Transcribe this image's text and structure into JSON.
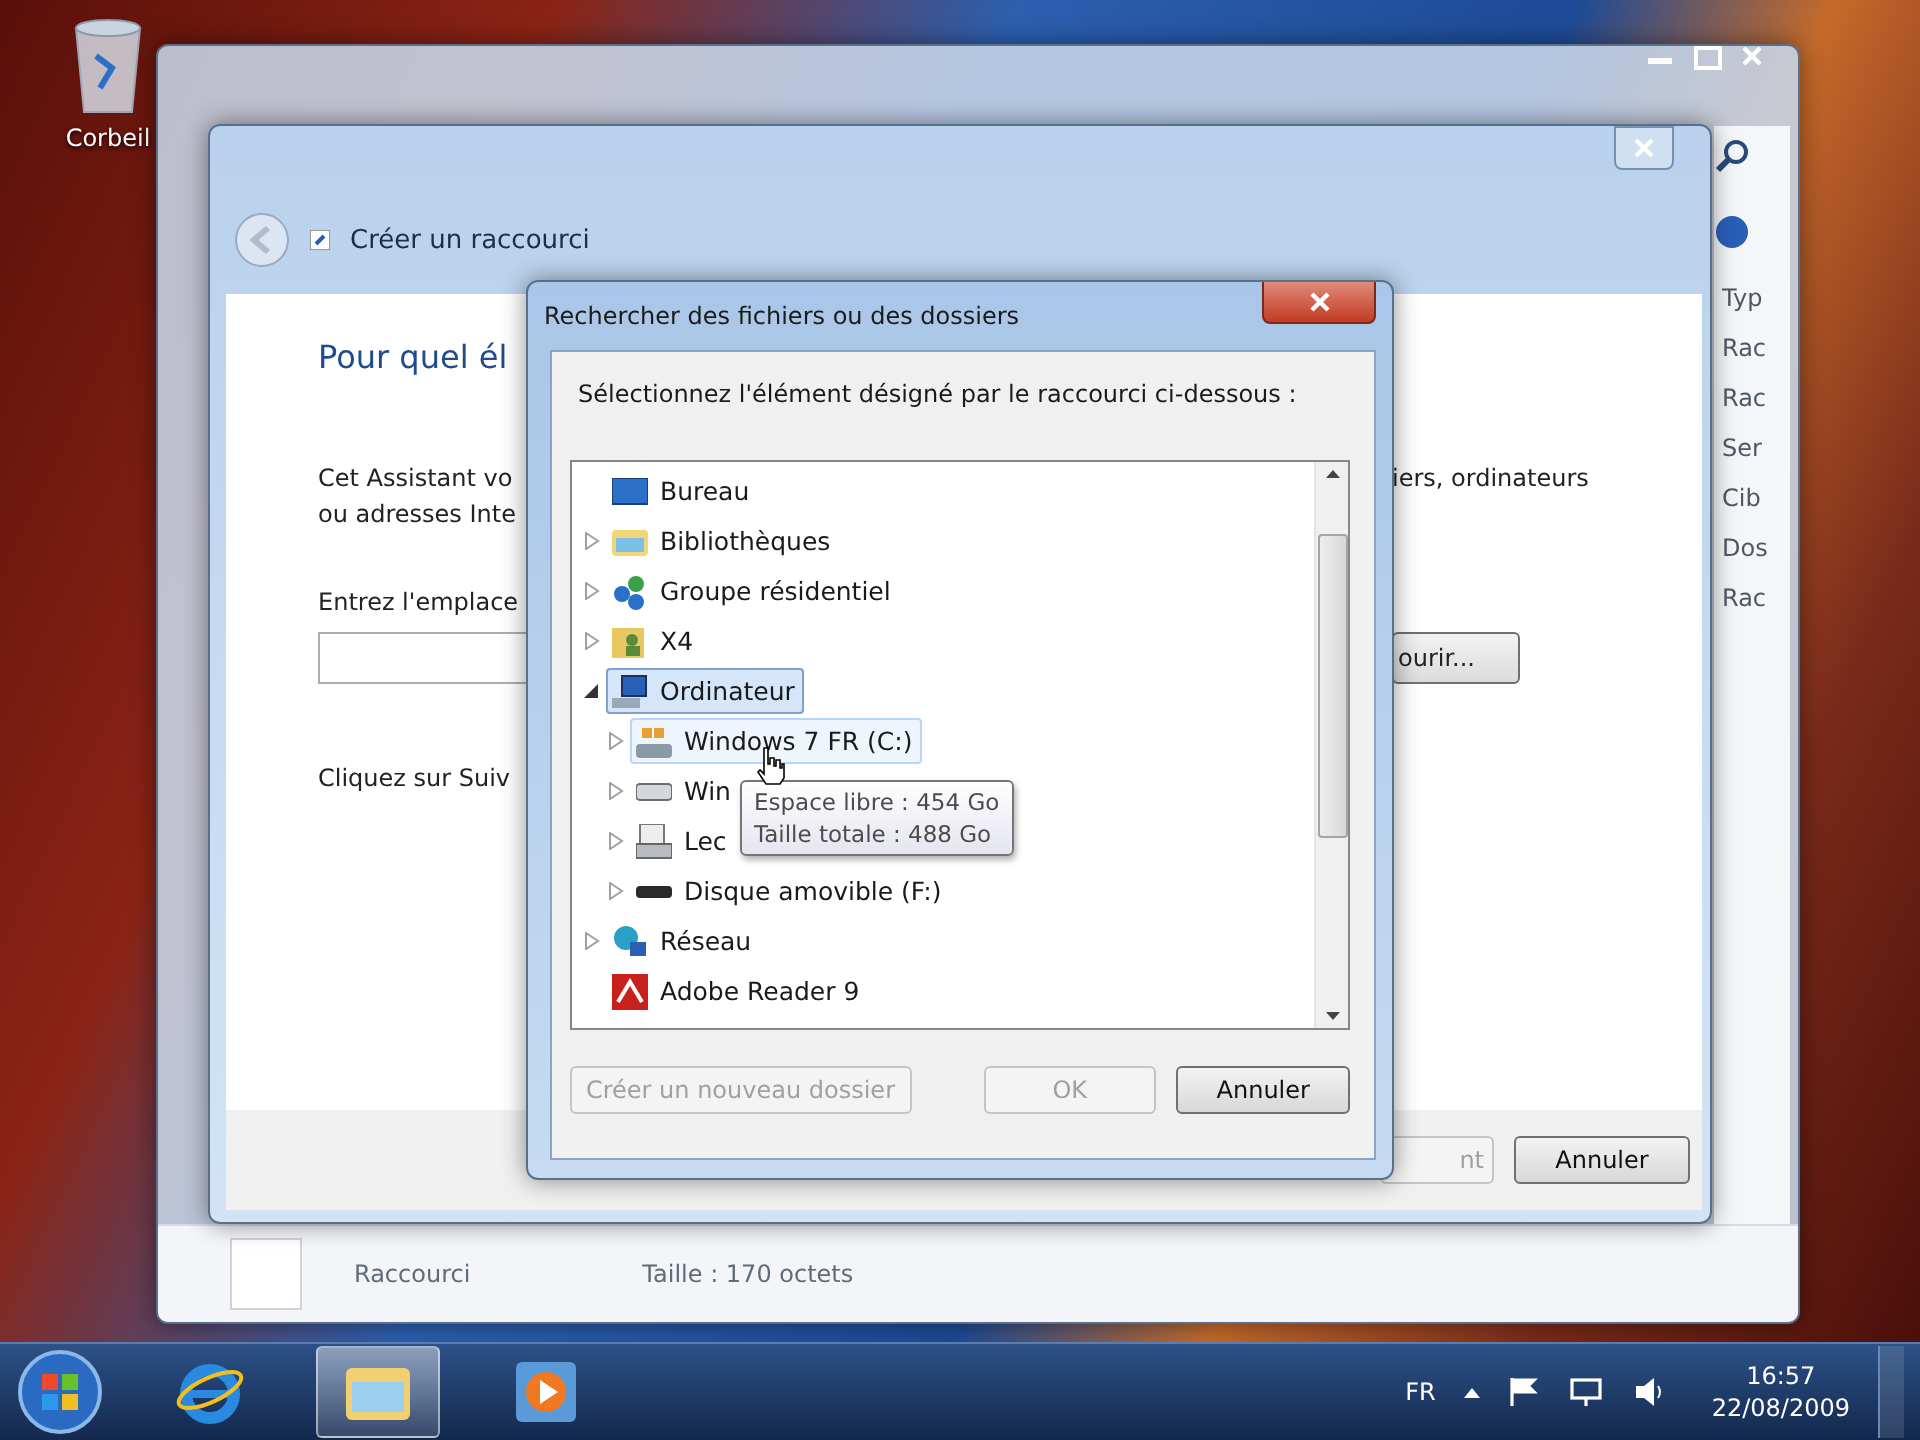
{
  "desktop": {
    "icons": [
      {
        "label": "Corbeil"
      }
    ]
  },
  "explorer": {
    "column_header": "Typ",
    "column_cells": [
      "Rac",
      "Rac",
      "Ser",
      "Cib",
      "Dos",
      "Rac"
    ],
    "details": {
      "type": "Raccourci",
      "size": "Taille : 170 octets"
    }
  },
  "wizard": {
    "title": "Créer un raccourci",
    "heading": "Pour quel él",
    "intro_lines": [
      "Cet Assistant vo",
      "ou adresses Inte"
    ],
    "intro_right": "iers, ordinateurs",
    "location_label": "Entrez l'emplace",
    "browse_button": "ourir...",
    "next_hint": "Cliquez sur Suiv",
    "buttons": [
      {
        "label": "nt",
        "disabled": true
      },
      {
        "label": "Annuler",
        "disabled": false
      }
    ]
  },
  "dialog": {
    "title": "Rechercher des fichiers ou des dossiers",
    "prompt": "Sélectionnez l'élément désigné par le raccourci ci-dessous :",
    "tree": [
      {
        "label": "Bureau",
        "kind": "desktop",
        "selected": false,
        "hovered": false
      },
      {
        "label": "Bibliothèques",
        "kind": "libraries",
        "expanded": false,
        "selected": false,
        "hovered": false
      },
      {
        "label": "Groupe résidentiel",
        "kind": "homegroup",
        "expanded": false,
        "selected": false,
        "hovered": false
      },
      {
        "label": "X4",
        "kind": "user",
        "expanded": false,
        "selected": false,
        "hovered": false
      },
      {
        "label": "Ordinateur",
        "kind": "computer",
        "expanded": true,
        "selected": true,
        "hovered": false,
        "children": [
          {
            "label": "Windows 7 FR (C:)",
            "kind": "system-drive",
            "expanded": false,
            "selected": false,
            "hovered": true
          },
          {
            "label": "Win",
            "kind": "drive",
            "expanded": false,
            "selected": false,
            "hovered": false
          },
          {
            "label": "Lec",
            "kind": "dvd",
            "expanded": false,
            "selected": false,
            "hovered": false
          },
          {
            "label": "Disque amovible (F:)",
            "kind": "removable",
            "expanded": false,
            "selected": false,
            "hovered": false
          }
        ]
      },
      {
        "label": "Réseau",
        "kind": "network",
        "expanded": false,
        "selected": false,
        "hovered": false
      },
      {
        "label": "Adobe Reader 9",
        "kind": "pdf",
        "selected": false,
        "hovered": false
      }
    ],
    "tooltip": [
      "Espace libre : 454 Go",
      "Taille totale : 488 Go"
    ],
    "buttons": [
      {
        "label": "Créer un nouveau dossier",
        "disabled": true
      },
      {
        "label": "OK",
        "disabled": true
      },
      {
        "label": "Annuler",
        "disabled": false
      }
    ]
  },
  "taskbar": {
    "apps": [
      {
        "kind": "browser",
        "active": false
      },
      {
        "kind": "folders",
        "active": true
      },
      {
        "kind": "media",
        "active": false
      }
    ],
    "language": "FR",
    "time": "16:57",
    "date": "22/08/2009"
  }
}
